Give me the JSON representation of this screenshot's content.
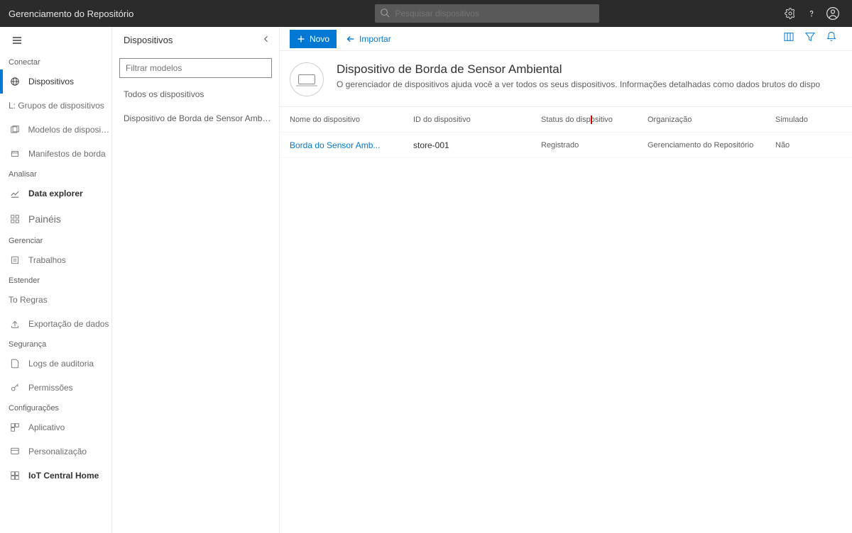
{
  "topbar": {
    "app_title": "Gerenciamento do Repositório",
    "search_placeholder": "Pesquisar dispositivos"
  },
  "sidebar": {
    "sections": {
      "conectar": "Conectar",
      "analisar": "Analisar",
      "gerenciar": "Gerenciar",
      "estender": "Estender",
      "seguranca": "Segurança",
      "config": "Configurações"
    },
    "items": {
      "dispositivos": "Dispositivos",
      "grupos": "L: Grupos de dispositivos",
      "modelos": "Modelos de dispositivo",
      "manifestos": "Manifestos de borda",
      "data_explorer": "Data explorer",
      "paineis": "Painéis",
      "trabalhos": "Trabalhos",
      "regras": "To Regras",
      "exportacao": "Exportação de dados",
      "logs": "Logs de auditoria",
      "permissoes": "Permissões",
      "aplicativo": "Aplicativo",
      "personalizacao": "Personalização",
      "iot_home": "IoT Central Home"
    }
  },
  "midpanel": {
    "title": "Dispositivos",
    "filter_placeholder": "Filtrar modelos",
    "all_devices": "Todos os dispositivos",
    "template1": "Dispositivo de Borda de Sensor Ambiental"
  },
  "main": {
    "new_btn": "Novo",
    "import_btn": "Importar",
    "page_title": "Dispositivo de Borda de Sensor Ambiental",
    "page_desc": "O gerenciador de dispositivos ajuda você a ver todos os seus dispositivos. Informações detalhadas como dados brutos do dispo",
    "columns": {
      "name": "Nome do dispositivo",
      "id": "ID do dispositivo",
      "status": "Status do dispositivo",
      "org": "Organização",
      "sim": "Simulado"
    },
    "rows": [
      {
        "name": "Borda do Sensor Amb...",
        "id": "store-001",
        "status": "Registrado",
        "org": "Gerenciamento do Repositório",
        "sim": "Não"
      }
    ]
  }
}
